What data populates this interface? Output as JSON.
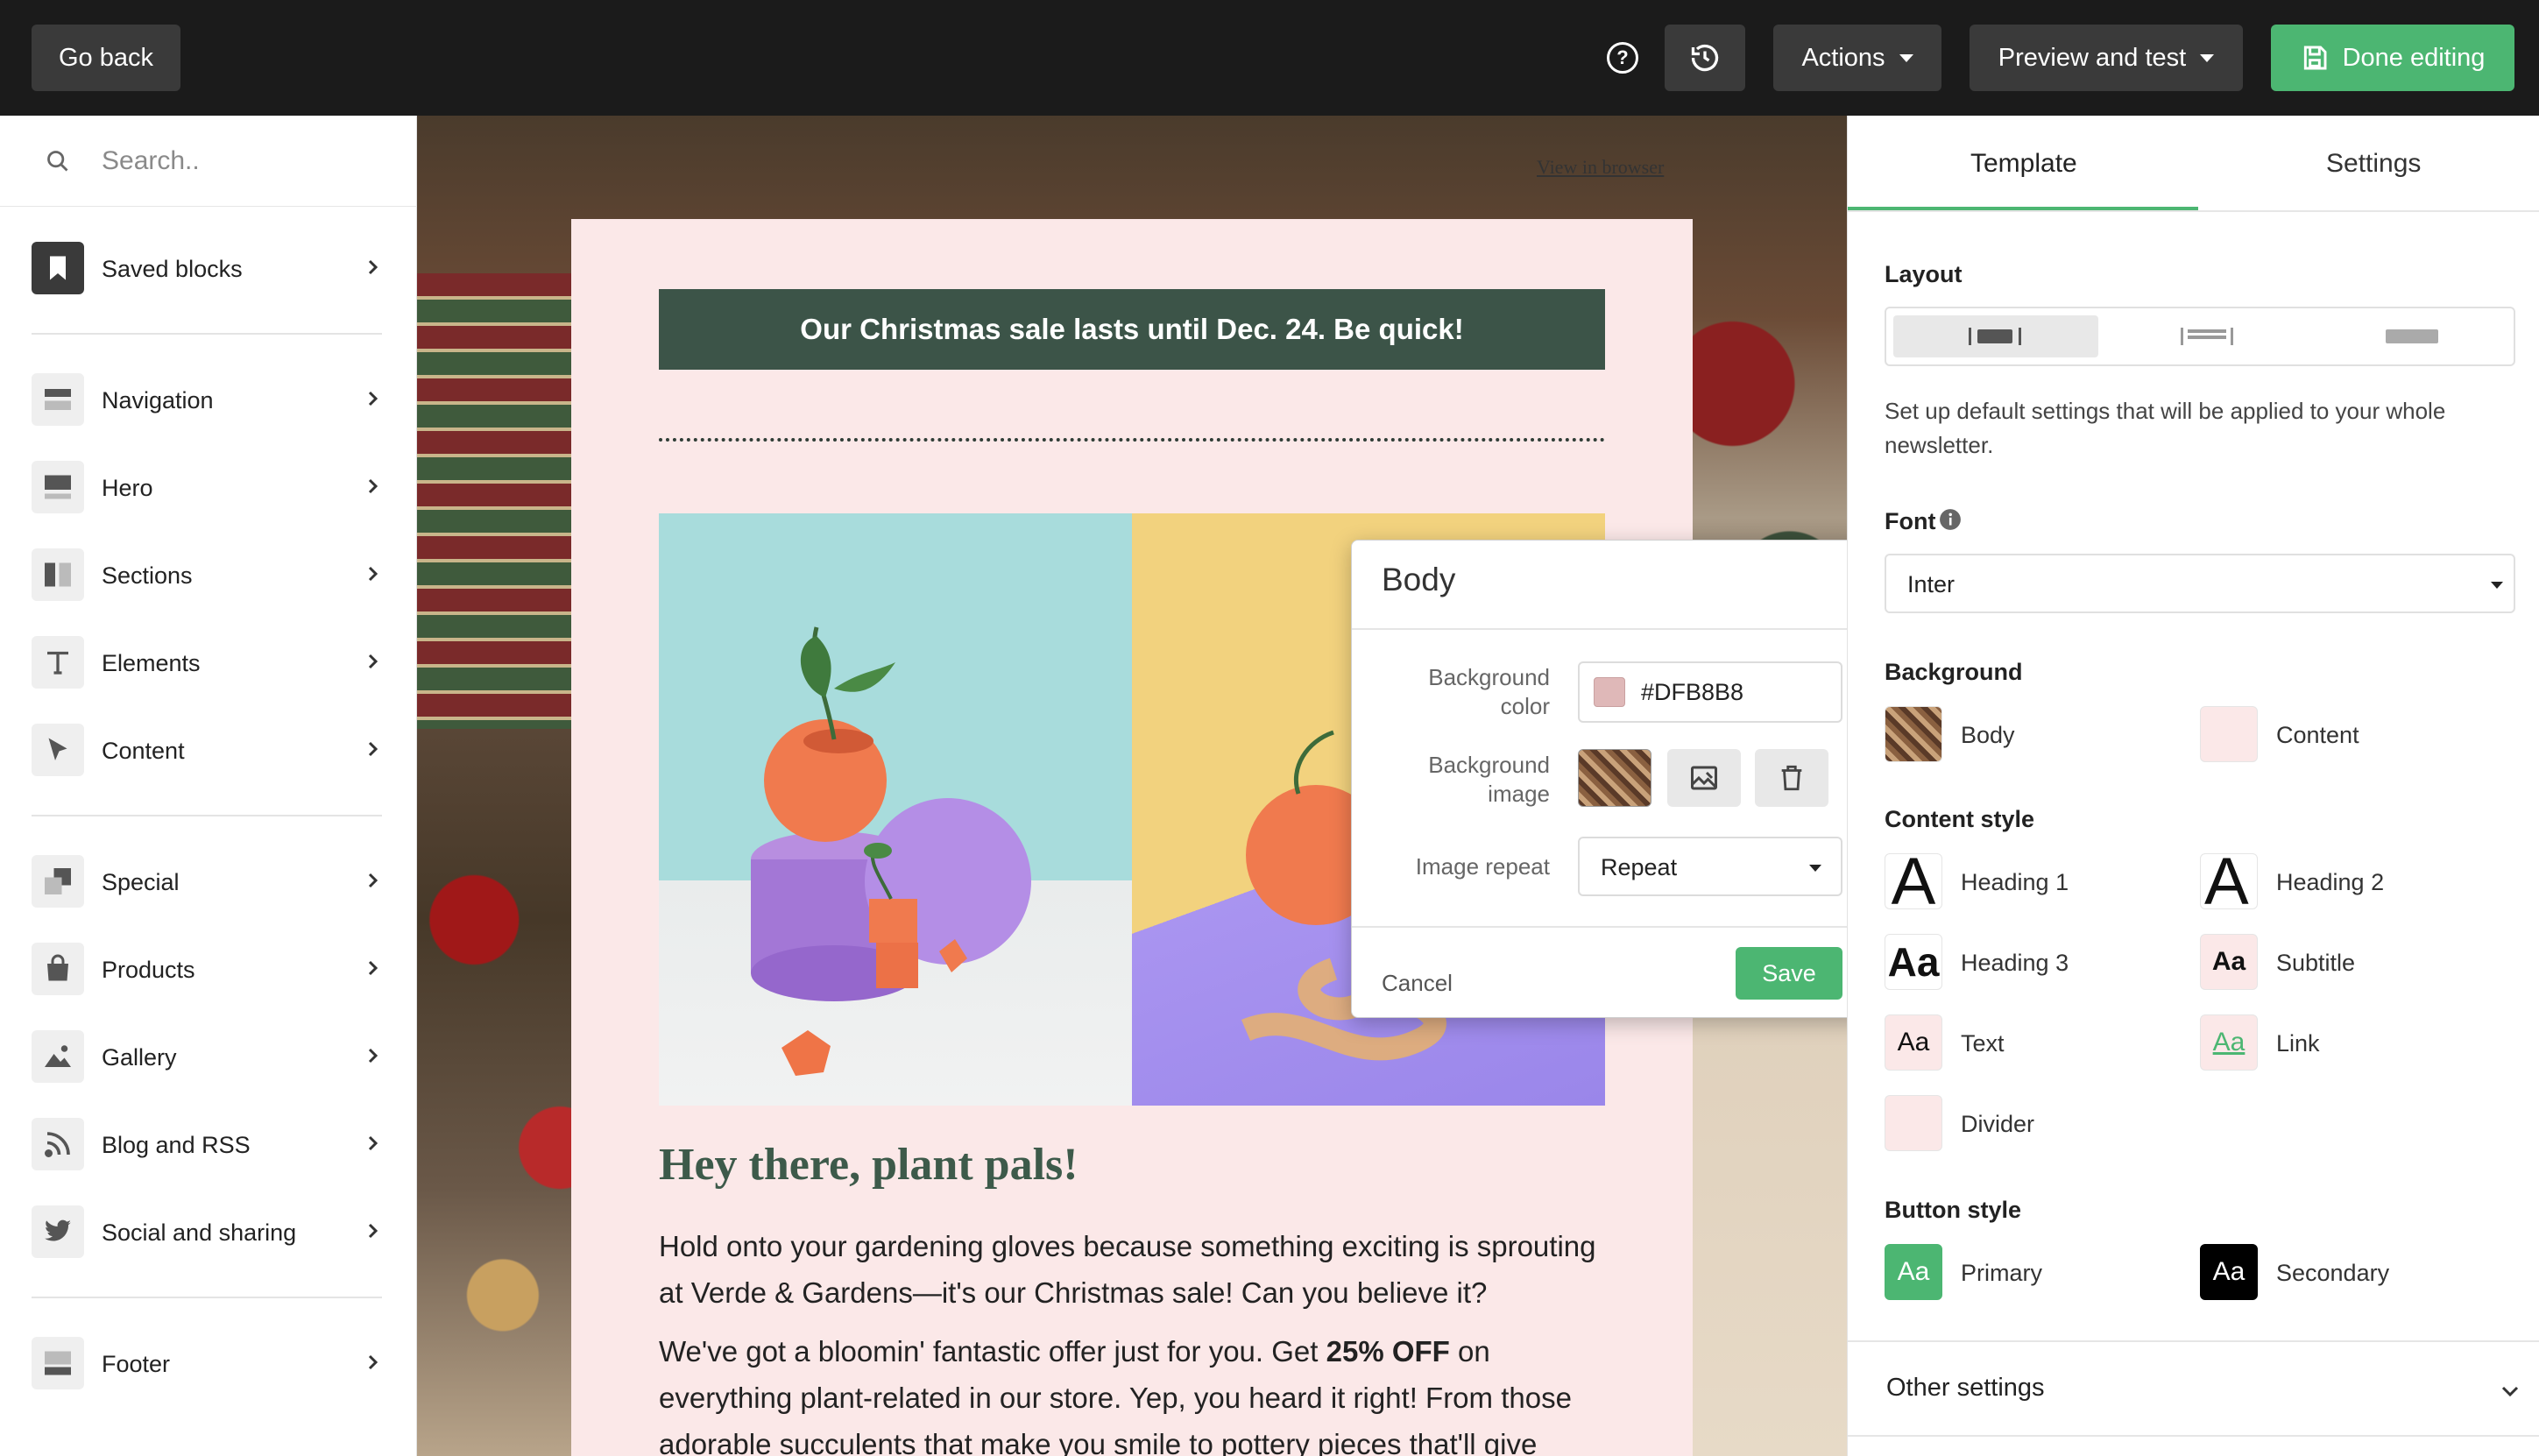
{
  "topbar": {
    "go_back": "Go back",
    "help_glyph": "?",
    "actions": "Actions",
    "preview": "Preview and test",
    "done": "Done editing"
  },
  "sidebar": {
    "search_placeholder": "Search..",
    "saved": "Saved blocks",
    "items": {
      "navigation": "Navigation",
      "hero": "Hero",
      "sections": "Sections",
      "elements": "Elements",
      "content": "Content",
      "special": "Special",
      "products": "Products",
      "gallery": "Gallery",
      "blog": "Blog and RSS",
      "social": "Social and sharing",
      "footer": "Footer"
    }
  },
  "email": {
    "view_in_browser": "View in browser",
    "banner": "Our Christmas sale lasts until Dec. 24. Be quick!",
    "heading": "Hey there, plant pals!",
    "para1": "Hold onto your gardening gloves because something exciting is sprouting at Verde & Gardens—it's our Christmas sale! Can you believe it?",
    "para2_a": "We've got a bloomin' fantastic offer just for you. Get ",
    "para2_bold": "25% OFF",
    "para2_b": " on everything plant-related in our store. Yep, you heard it right! From those adorable succulents that make you smile to pottery pieces that'll give"
  },
  "popup": {
    "title": "Body",
    "bg_color_label": "Background color",
    "bg_color_value": "#DFB8B8",
    "bg_image_label": "Background image",
    "repeat_label": "Image repeat",
    "repeat_value": "Repeat",
    "cancel": "Cancel",
    "save": "Save"
  },
  "panel": {
    "tab_template": "Template",
    "tab_settings": "Settings",
    "layout_label": "Layout",
    "description": "Set up default settings that will be applied to your whole newsletter.",
    "font_label": "Font",
    "font_value": "Inter",
    "background_label": "Background",
    "bg_body": "Body",
    "bg_content": "Content",
    "content_style_label": "Content style",
    "heading1": "Heading 1",
    "heading2": "Heading 2",
    "heading3": "Heading 3",
    "subtitle": "Subtitle",
    "text": "Text",
    "link": "Link",
    "divider": "Divider",
    "glyph_a": "A",
    "glyph_aa": "Aa",
    "button_style_label": "Button style",
    "primary": "Primary",
    "secondary": "Secondary",
    "other_settings": "Other settings"
  },
  "colors": {
    "accent": "#4CB672",
    "topbar": "#1B1B1B",
    "banner": "#3C5448",
    "email_bg": "#FBE8E8",
    "body_bg": "#DFB8B8"
  }
}
